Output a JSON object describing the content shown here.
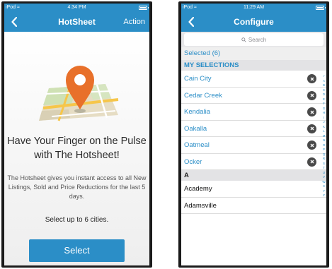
{
  "left": {
    "status": {
      "carrier": "iPod",
      "time": "4:34 PM"
    },
    "nav": {
      "title": "HotSheet",
      "action": "Action"
    },
    "headline": "Have Your Finger on the Pulse with The Hotsheet!",
    "description": "The Hotsheet gives you instant access to all New Listings, Sold and Price Reductions for the last 5 days.",
    "cities_prompt": "Select up to 6 cities.",
    "select_button": "Select"
  },
  "right": {
    "status": {
      "carrier": "iPod",
      "time": "11:29 AM"
    },
    "nav": {
      "title": "Configure"
    },
    "search": {
      "placeholder": "Search"
    },
    "selected_count": "Selected (6)",
    "section_selections": "MY SELECTIONS",
    "selections": [
      "Cain City",
      "Cedar Creek",
      "Kendalia",
      "Oakalla",
      "Oatmeal",
      "Ocker"
    ],
    "section_a": "A",
    "cities_a": [
      "Academy",
      "Adamsville"
    ],
    "index_letters": [
      "✓",
      "A",
      "B",
      "C",
      "D",
      "E",
      "F",
      "G",
      "H",
      "I",
      "J",
      "K",
      "L",
      "M",
      "N",
      "O",
      "P",
      "Q",
      "R",
      "S",
      "T",
      "U",
      "V",
      "W",
      "X",
      "Y",
      "Z"
    ]
  },
  "colors": {
    "accent": "#2b8ec7",
    "pin": "#e8702a",
    "remove_button": "#4a4a4a"
  },
  "icons": {
    "back": "chevron-left-icon",
    "remove": "x-circle-icon",
    "search": "magnifier-icon",
    "wifi": "wifi-icon",
    "battery": "battery-icon",
    "illustration": "map-pin-icon"
  }
}
